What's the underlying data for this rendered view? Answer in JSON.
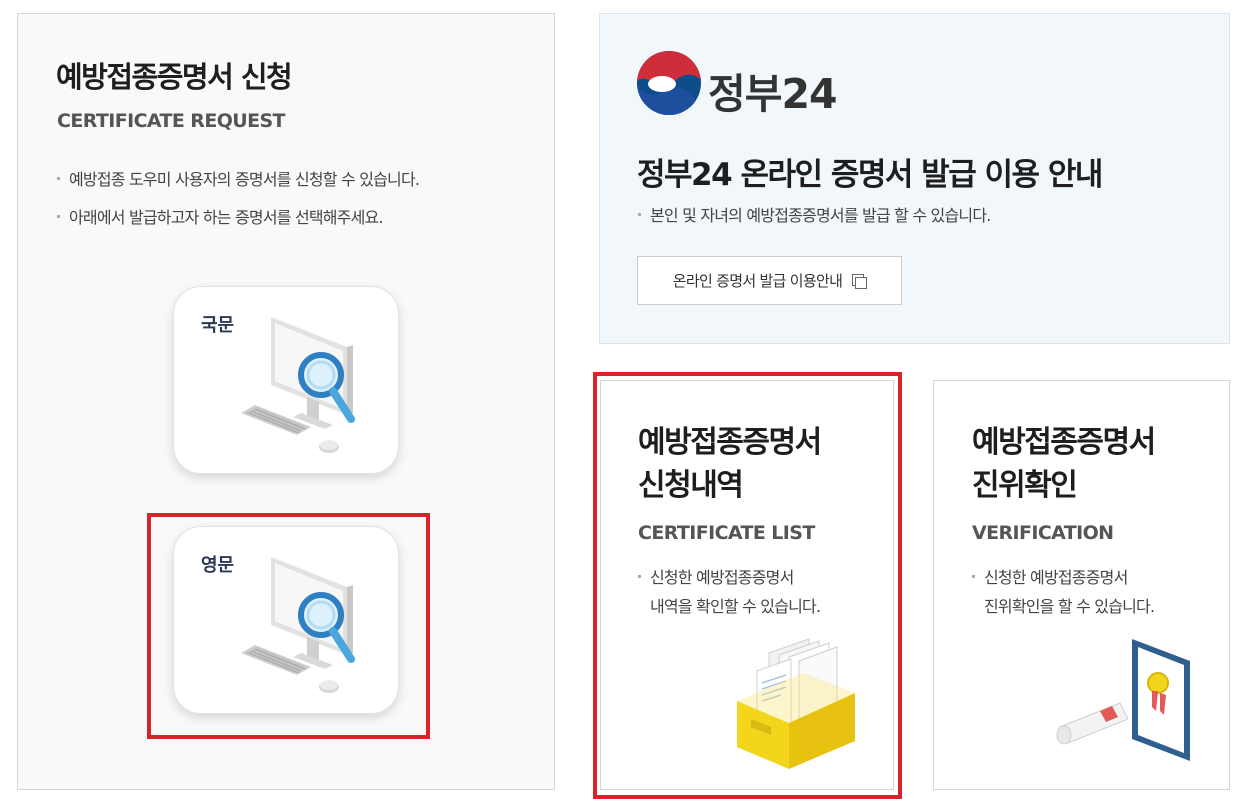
{
  "request": {
    "title": "예방접종증명서 신청",
    "subtitle": "CERTIFICATE REQUEST",
    "bullets": [
      "예방접종 도우미 사용자의 증명서를 신청할 수 있습니다.",
      "아래에서 발급하고자 하는 증명서를 선택해주세요."
    ],
    "korean_button": "국문",
    "english_button": "영문"
  },
  "gov24": {
    "logo_text": "정부24",
    "title": "정부24 온라인 증명서 발급 이용 안내",
    "bullet": "본인 및 자녀의 예방접종증명서를 발급 할 수 있습니다.",
    "button_label": "온라인 증명서 발급 이용안내"
  },
  "list_card": {
    "title_line1": "예방접종증명서",
    "title_line2": "신청내역",
    "subtitle": "CERTIFICATE LIST",
    "desc_line1": "신청한 예방접종증명서",
    "desc_line2": "내역을 확인할 수 있습니다."
  },
  "verify_card": {
    "title_line1": "예방접종증명서",
    "title_line2": "진위확인",
    "subtitle": "VERIFICATION",
    "desc_line1": "신청한 예방접종증명서",
    "desc_line2": "진위확인을 할 수 있습니다."
  },
  "colors": {
    "highlight": "#d8232a",
    "gov_red": "#cd2e3a",
    "gov_blue": "#0f4c8a",
    "gov_panel_bg": "#f1f7fb"
  },
  "icons": [
    "monitor-magnifier-icon",
    "copy-icon",
    "file-box-icon",
    "certificate-icon"
  ]
}
